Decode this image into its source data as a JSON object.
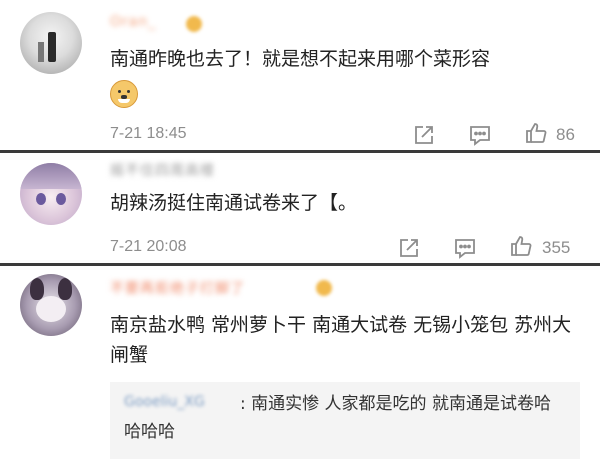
{
  "comments": [
    {
      "username": "Oran_",
      "text": "南通昨晚也去了！就是想不起来用哪个菜形容",
      "time": "7-21 18:45",
      "likes": "86"
    },
    {
      "username": "摇不住四周高楼",
      "text": "胡辣汤挺住南通试卷来了【。",
      "time": "7-21 20:08",
      "likes": "355"
    },
    {
      "username": "不要再拒绝子打脚了",
      "text": "南京盐水鸭 常州萝卜干 南通大试卷 无锡小笼包 苏州大闸蟹",
      "reply": {
        "username": "Gooeliu_XG",
        "text": ": 南通实惨 人家都是吃的 就南通是试卷哈哈哈哈"
      }
    }
  ],
  "icons": [
    "share-icon",
    "comment-icon",
    "like-icon"
  ],
  "colors": {
    "meta": "#8d8d8d",
    "separator": "#3a3a3a",
    "reply_bg": "#f4f4f4"
  }
}
